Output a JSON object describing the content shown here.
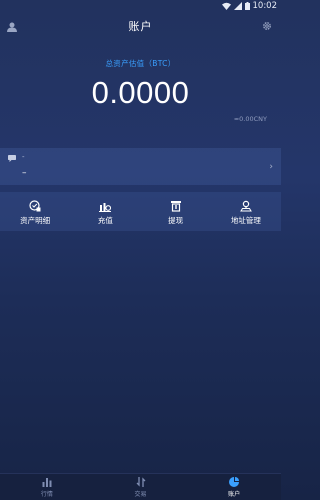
{
  "status_bar": {
    "time": "10:02"
  },
  "header": {
    "title": "账户"
  },
  "asset": {
    "label": "总资产估值（BTC）",
    "value": "0.0000",
    "cny": "≈0.00CNY"
  },
  "notice": {
    "title": "-",
    "text": "–"
  },
  "actions": [
    {
      "label": "资产明细",
      "icon": "asset-detail-icon"
    },
    {
      "label": "充值",
      "icon": "deposit-icon"
    },
    {
      "label": "提现",
      "icon": "withdraw-icon"
    },
    {
      "label": "地址管理",
      "icon": "address-icon"
    }
  ],
  "bottom_nav": [
    {
      "label": "行情",
      "icon": "chart-icon",
      "active": false
    },
    {
      "label": "交易",
      "icon": "trade-icon",
      "active": false
    },
    {
      "label": "账户",
      "icon": "account-pie-icon",
      "active": true
    }
  ],
  "colors": {
    "accent": "#3aa0ff",
    "background": "#22325e"
  }
}
